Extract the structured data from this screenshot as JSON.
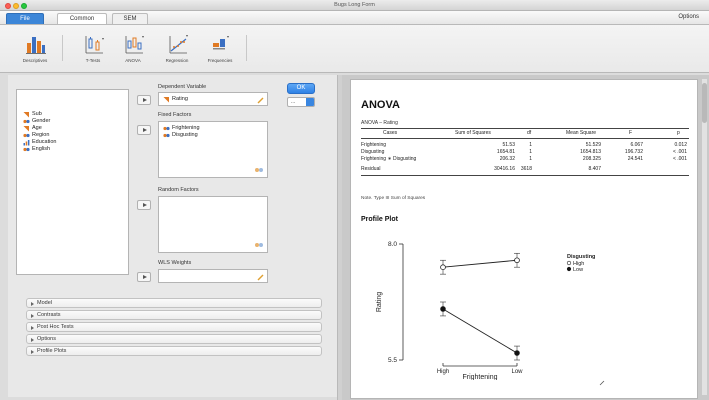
{
  "window": {
    "title": "Bugs Long Form"
  },
  "tabs": {
    "file": "File",
    "common": "Common",
    "sem": "SEM",
    "options": "Options"
  },
  "ribbon": [
    {
      "label": "Descriptives",
      "icon": "bar-chart-icon"
    },
    {
      "label": "T-Tests",
      "icon": "t-test-icon"
    },
    {
      "label": "ANOVA",
      "icon": "anova-icon"
    },
    {
      "label": "Regression",
      "icon": "regression-icon"
    },
    {
      "label": "Frequencies",
      "icon": "frequencies-icon"
    }
  ],
  "variables": [
    "Sub",
    "Gender",
    "Age",
    "Region",
    "Education",
    "English"
  ],
  "dependent": {
    "label": "Dependent Variable",
    "value": "Rating"
  },
  "fixed": {
    "label": "Fixed Factors",
    "items": [
      "Frightening",
      "Disgusting"
    ]
  },
  "random": {
    "label": "Random Factors"
  },
  "wls": {
    "label": "WLS Weights"
  },
  "ok_label": "OK",
  "mode_value": "...",
  "accordion": [
    "Model",
    "Contrasts",
    "Post Hoc Tests",
    "Options",
    "Profile Plots"
  ],
  "results": {
    "title": "ANOVA",
    "subtitle": "ANOVA – Rating",
    "columns": [
      "Cases",
      "Sum of Squares",
      "df",
      "Mean Square",
      "F",
      "p"
    ],
    "rows": [
      [
        "Frightening",
        "51.53",
        "1",
        "51.529",
        "6.067",
        "0.012"
      ],
      [
        "Disgusting",
        "1654.81",
        "1",
        "1654.813",
        "196.732",
        "< .001"
      ],
      [
        "Frightening ∗ Disgusting",
        "206.32",
        "1",
        "208.325",
        "24.541",
        "< .001"
      ],
      [
        "Residual",
        "30416.16",
        "3618",
        "8.407",
        "",
        ""
      ]
    ],
    "note": "Note. Type III Sum of Squares",
    "plot_title": "Profile Plot"
  },
  "chart_data": {
    "type": "line",
    "x": [
      "High",
      "Low"
    ],
    "xlabel": "Frightening",
    "ylabel": "Rating",
    "ytick_labels": [
      "8.0",
      "5.5"
    ],
    "legend_title": "Disgusting",
    "legend_position": "right",
    "series": [
      {
        "name": "High",
        "values": [
          7.5,
          7.65
        ],
        "errors": [
          0.15,
          0.15
        ],
        "marker": "open-circle"
      },
      {
        "name": "Low",
        "values": [
          6.6,
          5.65
        ],
        "errors": [
          0.15,
          0.15
        ],
        "marker": "filled-circle"
      }
    ],
    "ylim": [
      5.5,
      8.0
    ]
  }
}
